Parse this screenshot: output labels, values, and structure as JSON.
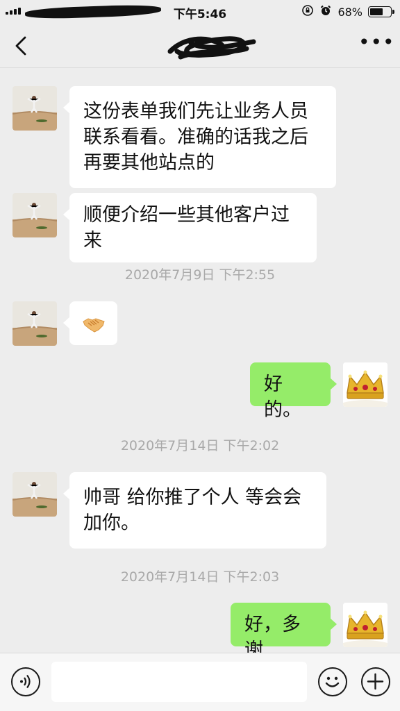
{
  "status_bar": {
    "time": "下午5:46",
    "battery": "68%",
    "battery_level": 0.68
  },
  "nav": {
    "title": "",
    "more": "•••"
  },
  "messages": [
    {
      "type": "text",
      "from": "friend",
      "text": "这份表单我们先让业务人员联系看看。准确的话我之后再要其他站点的"
    },
    {
      "type": "text",
      "from": "friend",
      "text": "顺便介绍一些其他客户过来"
    },
    {
      "type": "time",
      "text": "2020年7月9日 下午2:55"
    },
    {
      "type": "sticker",
      "from": "friend",
      "emoji": "handshake-emoji",
      "glyph": "🤝"
    },
    {
      "type": "text",
      "from": "me",
      "text": "好的。"
    },
    {
      "type": "time",
      "text": "2020年7月14日 下午2:02"
    },
    {
      "type": "text",
      "from": "friend",
      "text": "帅哥 给你推了个人 等会会加你。"
    },
    {
      "type": "time",
      "text": "2020年7月14日 下午2:03"
    },
    {
      "type": "text",
      "from": "me",
      "text": "好，多谢"
    }
  ],
  "icons": {
    "back": "chevron-left-icon",
    "more": "more-icon",
    "voice": "voice-icon",
    "emoji": "emoji-icon",
    "plus": "plus-icon"
  },
  "colors": {
    "background": "#ededed",
    "incoming_bubble": "#ffffff",
    "outgoing_bubble": "#95ec69",
    "timestamp": "#a9a9a9"
  },
  "input": {
    "value": "",
    "placeholder": ""
  }
}
